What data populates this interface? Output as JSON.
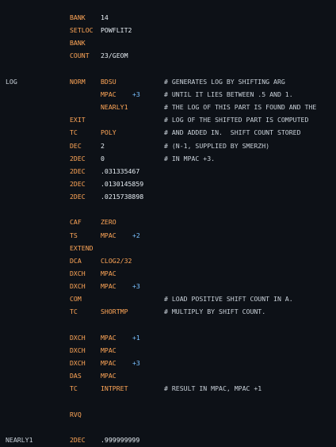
{
  "editor": {
    "background": "#0d1117",
    "colors": {
      "label": "#c9d1d9",
      "opcode": "#ffa657",
      "operand": "#e6edf3",
      "modifier": "#79c0ff",
      "comment": "#c9d1d9"
    },
    "lines": [
      {
        "label": "",
        "op": "BANK",
        "arg": "14",
        "mod": "",
        "comment": ""
      },
      {
        "label": "",
        "op": "SETLOC",
        "arg": "POWFLIT2",
        "mod": "",
        "comment": ""
      },
      {
        "label": "",
        "op": "BANK",
        "arg": "",
        "mod": "",
        "comment": ""
      },
      {
        "label": "",
        "op": "COUNT",
        "arg": "23/GEOM",
        "mod": "",
        "comment": ""
      },
      {
        "label": "",
        "op": "",
        "arg": "",
        "mod": "",
        "comment": ""
      },
      {
        "label": "LOG",
        "op": "NORM",
        "arg": "BDSU",
        "mod": "",
        "comment": "# GENERATES LOG BY SHIFTING ARG"
      },
      {
        "label": "",
        "op": "",
        "arg": "MPAC",
        "mod": "+3",
        "comment": "# UNTIL IT LIES BETWEEN .5 AND 1."
      },
      {
        "label": "",
        "op": "",
        "arg": "NEARLY1",
        "mod": "",
        "comment": "# THE LOG OF THIS PART IS FOUND AND THE"
      },
      {
        "label": "",
        "op": "EXIT",
        "arg": "",
        "mod": "",
        "comment": "# LOG OF THE SHIFTED PART IS COMPUTED"
      },
      {
        "label": "",
        "op": "TC",
        "arg": "POLY",
        "mod": "",
        "comment": "# AND ADDED IN.  SHIFT COUNT STORED"
      },
      {
        "label": "",
        "op": "DEC",
        "arg": "2",
        "mod": "",
        "comment": "# (N-1, SUPPLIED BY SMERZH)"
      },
      {
        "label": "",
        "op": "2DEC",
        "arg": "0",
        "mod": "",
        "comment": "# IN MPAC +3."
      },
      {
        "label": "",
        "op": "2DEC",
        "arg": ".031335467",
        "mod": "",
        "comment": ""
      },
      {
        "label": "",
        "op": "2DEC",
        "arg": ".0130145859",
        "mod": "",
        "comment": ""
      },
      {
        "label": "",
        "op": "2DEC",
        "arg": ".0215738898",
        "mod": "",
        "comment": ""
      },
      {
        "label": "",
        "op": "",
        "arg": "",
        "mod": "",
        "comment": ""
      },
      {
        "label": "",
        "op": "CAF",
        "arg": "ZERO",
        "mod": "",
        "comment": ""
      },
      {
        "label": "",
        "op": "TS",
        "arg": "MPAC",
        "mod": "+2",
        "comment": ""
      },
      {
        "label": "",
        "op": "EXTEND",
        "arg": "",
        "mod": "",
        "comment": ""
      },
      {
        "label": "",
        "op": "DCA",
        "arg": "CLOG2/32",
        "mod": "",
        "comment": ""
      },
      {
        "label": "",
        "op": "DXCH",
        "arg": "MPAC",
        "mod": "",
        "comment": ""
      },
      {
        "label": "",
        "op": "DXCH",
        "arg": "MPAC",
        "mod": "+3",
        "comment": ""
      },
      {
        "label": "",
        "op": "COM",
        "arg": "",
        "mod": "",
        "comment": "# LOAD POSITIVE SHIFT COUNT IN A."
      },
      {
        "label": "",
        "op": "TC",
        "arg": "SHORTMP",
        "mod": "",
        "comment": "# MULTIPLY BY SHIFT COUNT."
      },
      {
        "label": "",
        "op": "",
        "arg": "",
        "mod": "",
        "comment": ""
      },
      {
        "label": "",
        "op": "DXCH",
        "arg": "MPAC",
        "mod": "+1",
        "comment": ""
      },
      {
        "label": "",
        "op": "DXCH",
        "arg": "MPAC",
        "mod": "",
        "comment": ""
      },
      {
        "label": "",
        "op": "DXCH",
        "arg": "MPAC",
        "mod": "+3",
        "comment": ""
      },
      {
        "label": "",
        "op": "DAS",
        "arg": "MPAC",
        "mod": "",
        "comment": ""
      },
      {
        "label": "",
        "op": "TC",
        "arg": "INTPRET",
        "mod": "",
        "comment": "# RESULT IN MPAC, MPAC +1"
      },
      {
        "label": "",
        "op": "",
        "arg": "",
        "mod": "",
        "comment": ""
      },
      {
        "label": "",
        "op": "RVQ",
        "arg": "",
        "mod": "",
        "comment": ""
      },
      {
        "label": "",
        "op": "",
        "arg": "",
        "mod": "",
        "comment": ""
      },
      {
        "label": "NEARLY1",
        "op": "2DEC",
        "arg": ".999999999",
        "mod": "",
        "comment": ""
      }
    ]
  }
}
